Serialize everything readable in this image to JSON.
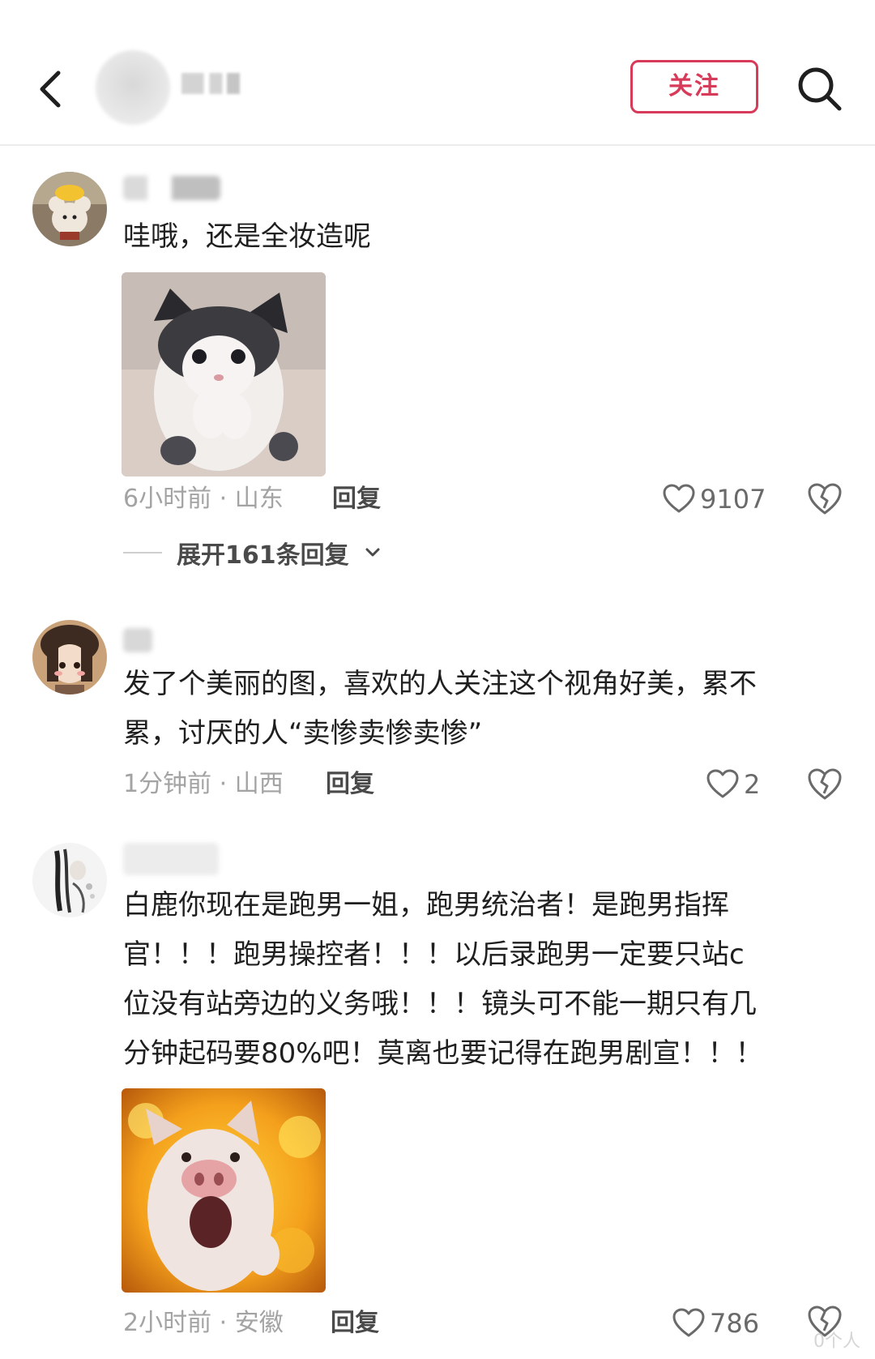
{
  "header": {
    "follow_label": "关注"
  },
  "comments": [
    {
      "text": "哇哦，还是全妆造呢",
      "time": "6小时前",
      "location": "山东",
      "reply_label": "回复",
      "likes": "9107",
      "expand_label": "展开161条回复"
    },
    {
      "text_line1": "发了个美丽的图，喜欢的人关注这个视角好美，累不",
      "text_line2": "累，讨厌的人“卖惨卖惨卖惨”",
      "time": "1分钟前",
      "location": "山西",
      "reply_label": "回复",
      "likes": "2"
    },
    {
      "text_line1": "白鹿你现在是跑男一姐，跑男统治者！是跑男指挥",
      "text_line2": "官！！！跑男操控者！！！以后录跑男一定要只站c",
      "text_line3": "位没有站旁边的义务哦！！！镜头可不能一期只有几",
      "text_line4": "分钟起码要80%吧！莫离也要记得在跑男剧宣！！！",
      "time": "2小时前",
      "location": "安徽",
      "reply_label": "回复",
      "likes": "786"
    }
  ],
  "separator": "·",
  "watermark": "0个人",
  "icons": {
    "back": "chevron-left-icon",
    "search": "search-icon",
    "like": "heart-icon",
    "dislike": "broken-heart-icon",
    "expand": "chevron-down-icon"
  },
  "colors": {
    "accent": "#d83a5a",
    "meta": "#a3a3a3"
  }
}
